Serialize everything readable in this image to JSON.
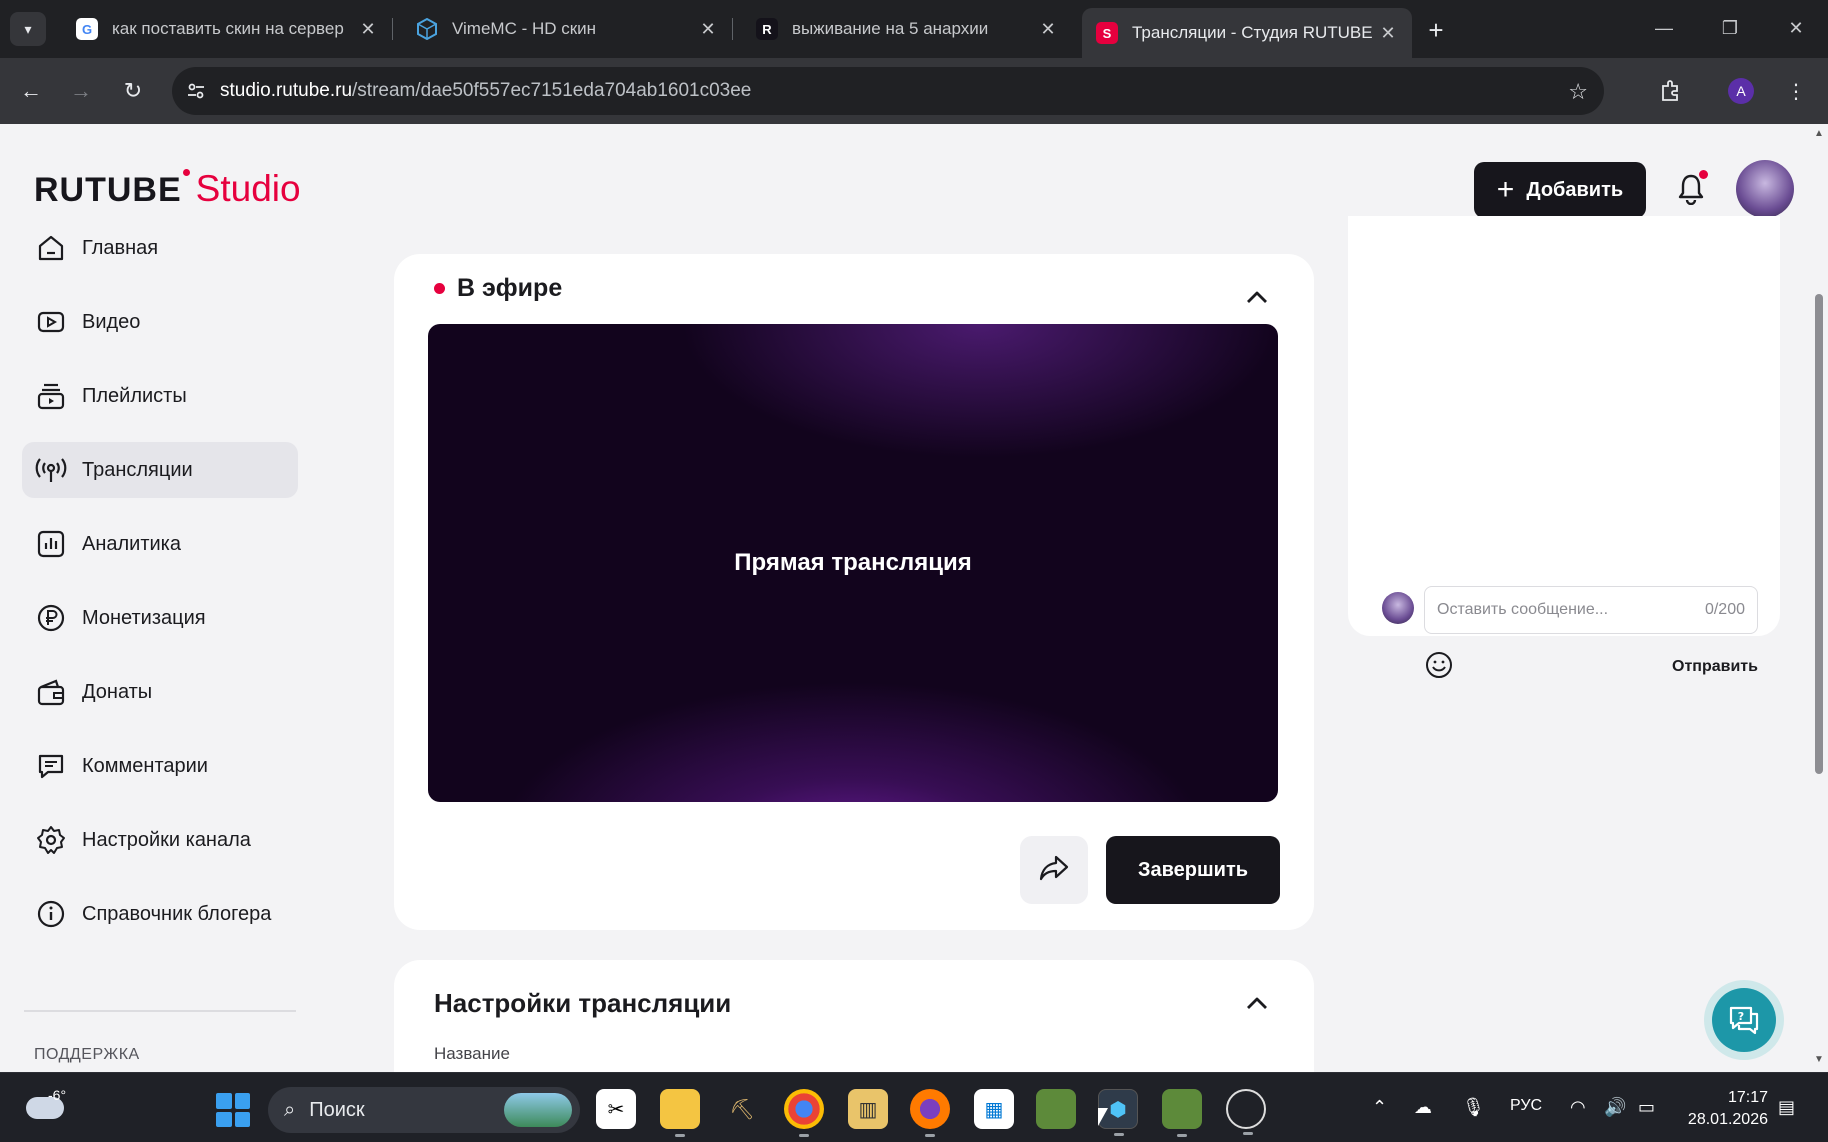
{
  "browser": {
    "tabs": [
      {
        "title": "как поставить скин на сервер",
        "favicon": "google-icon"
      },
      {
        "title": "VimeMC - HD скин",
        "favicon": "vimemc-icon"
      },
      {
        "title": "выживание на 5 анархии",
        "favicon": "rutube-r-icon"
      },
      {
        "title": "Трансляции - Студия RUTUBE",
        "favicon": "rutube-studio-icon"
      }
    ],
    "url_host": "studio.rutube.ru",
    "url_path": "/stream/dae50f557ec7151eda704ab1601c03ee",
    "profile_letter": "A"
  },
  "header": {
    "logo_main": "RUTUBE",
    "logo_sub": "Studio",
    "add_label": "Добавить"
  },
  "sidebar": {
    "items": [
      {
        "label": "Главная",
        "icon": "home-icon"
      },
      {
        "label": "Видео",
        "icon": "video-icon"
      },
      {
        "label": "Плейлисты",
        "icon": "playlist-icon"
      },
      {
        "label": "Трансляции",
        "icon": "broadcast-icon",
        "active": true
      },
      {
        "label": "Аналитика",
        "icon": "analytics-icon"
      },
      {
        "label": "Монетизация",
        "icon": "ruble-icon"
      },
      {
        "label": "Донаты",
        "icon": "wallet-icon"
      },
      {
        "label": "Комментарии",
        "icon": "comment-icon"
      },
      {
        "label": "Настройки канала",
        "icon": "gear-icon"
      },
      {
        "label": "Справочник блогера",
        "icon": "info-icon"
      }
    ],
    "support_label": "ПОДДЕРЖКА"
  },
  "live": {
    "status_label": "В эфире",
    "player_label": "Прямая трансляция",
    "finish_label": "Завершить"
  },
  "settings": {
    "title": "Настройки трансляции",
    "name_label": "Название"
  },
  "chat": {
    "placeholder": "Оставить сообщение...",
    "counter": "0/200",
    "send_label": "Отправить"
  },
  "taskbar": {
    "weather_temp": "-6°",
    "search_label": "Поиск",
    "lang": "РУС",
    "time": "17:17",
    "date": "28.01.2026"
  },
  "colors": {
    "brand_red": "#e6003e",
    "dark": "#17161c",
    "help_teal": "#1d97a8"
  }
}
